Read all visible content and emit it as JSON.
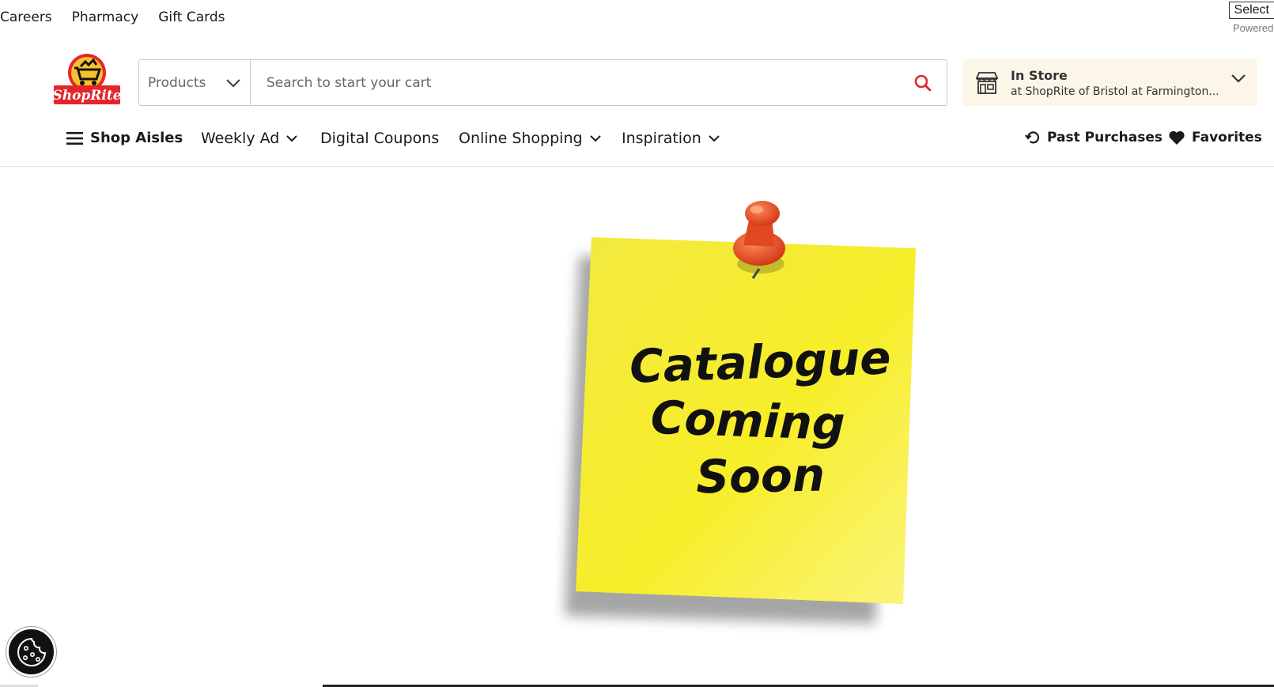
{
  "utility_links": [
    "Careers",
    "Pharmacy",
    "Gift Cards"
  ],
  "translate": {
    "select_label": "Select",
    "powered_label": "Powered"
  },
  "logo": {
    "text": "ShopRite"
  },
  "search": {
    "category": "Products",
    "placeholder": "Search to start your cart"
  },
  "store": {
    "title": "In Store",
    "subtitle": "at ShopRite of Bristol at Farmington..."
  },
  "nav": {
    "shop_aisles": "Shop Aisles",
    "weekly_ad": "Weekly Ad",
    "digital_coupons": "Digital Coupons",
    "online_shopping": "Online Shopping",
    "inspiration": "Inspiration",
    "past_purchases": "Past Purchases",
    "favorites": "Favorites"
  },
  "note": {
    "line1": "Catalogue",
    "line2": "Coming",
    "line3": "Soon"
  },
  "colors": {
    "brand_red": "#e3262c",
    "note_yellow": "#f7ea2e",
    "store_bg": "#fbf6e8",
    "pin_red": "#e1481f"
  }
}
